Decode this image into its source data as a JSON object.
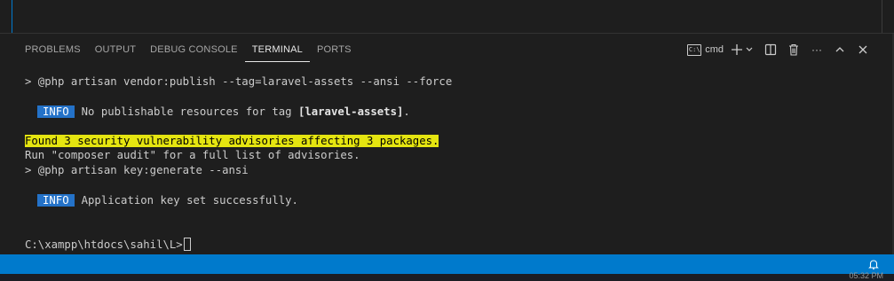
{
  "panel": {
    "tabs": [
      {
        "label": "PROBLEMS",
        "active": false
      },
      {
        "label": "OUTPUT",
        "active": false
      },
      {
        "label": "DEBUG CONSOLE",
        "active": false
      },
      {
        "label": "TERMINAL",
        "active": true
      },
      {
        "label": "PORTS",
        "active": false
      }
    ],
    "terminal_name": "cmd",
    "terminal_icon_text": "C:\\",
    "more_label": "···"
  },
  "terminal": {
    "line1": "> @php artisan vendor:publish --tag=laravel-assets --ansi --force",
    "info_badge": "INFO",
    "line2_text": "No publishable resources for tag ",
    "line2_bold": "[laravel-assets]",
    "line2_end": ".",
    "line3_warning": "Found 3 security vulnerability advisories affecting 3 packages.",
    "line4": "Run \"composer audit\" for a full list of advisories.",
    "line5": "> @php artisan key:generate --ansi",
    "info_badge2": "INFO",
    "line6": "Application key set successfully.",
    "prompt": "C:\\xampp\\htdocs\\sahil\\L>"
  },
  "taskbar": {
    "clock": "05:32 PM"
  },
  "colors": {
    "accent": "#007acc",
    "info_badge": "#2472c8",
    "warning_bg": "#e5e510"
  }
}
